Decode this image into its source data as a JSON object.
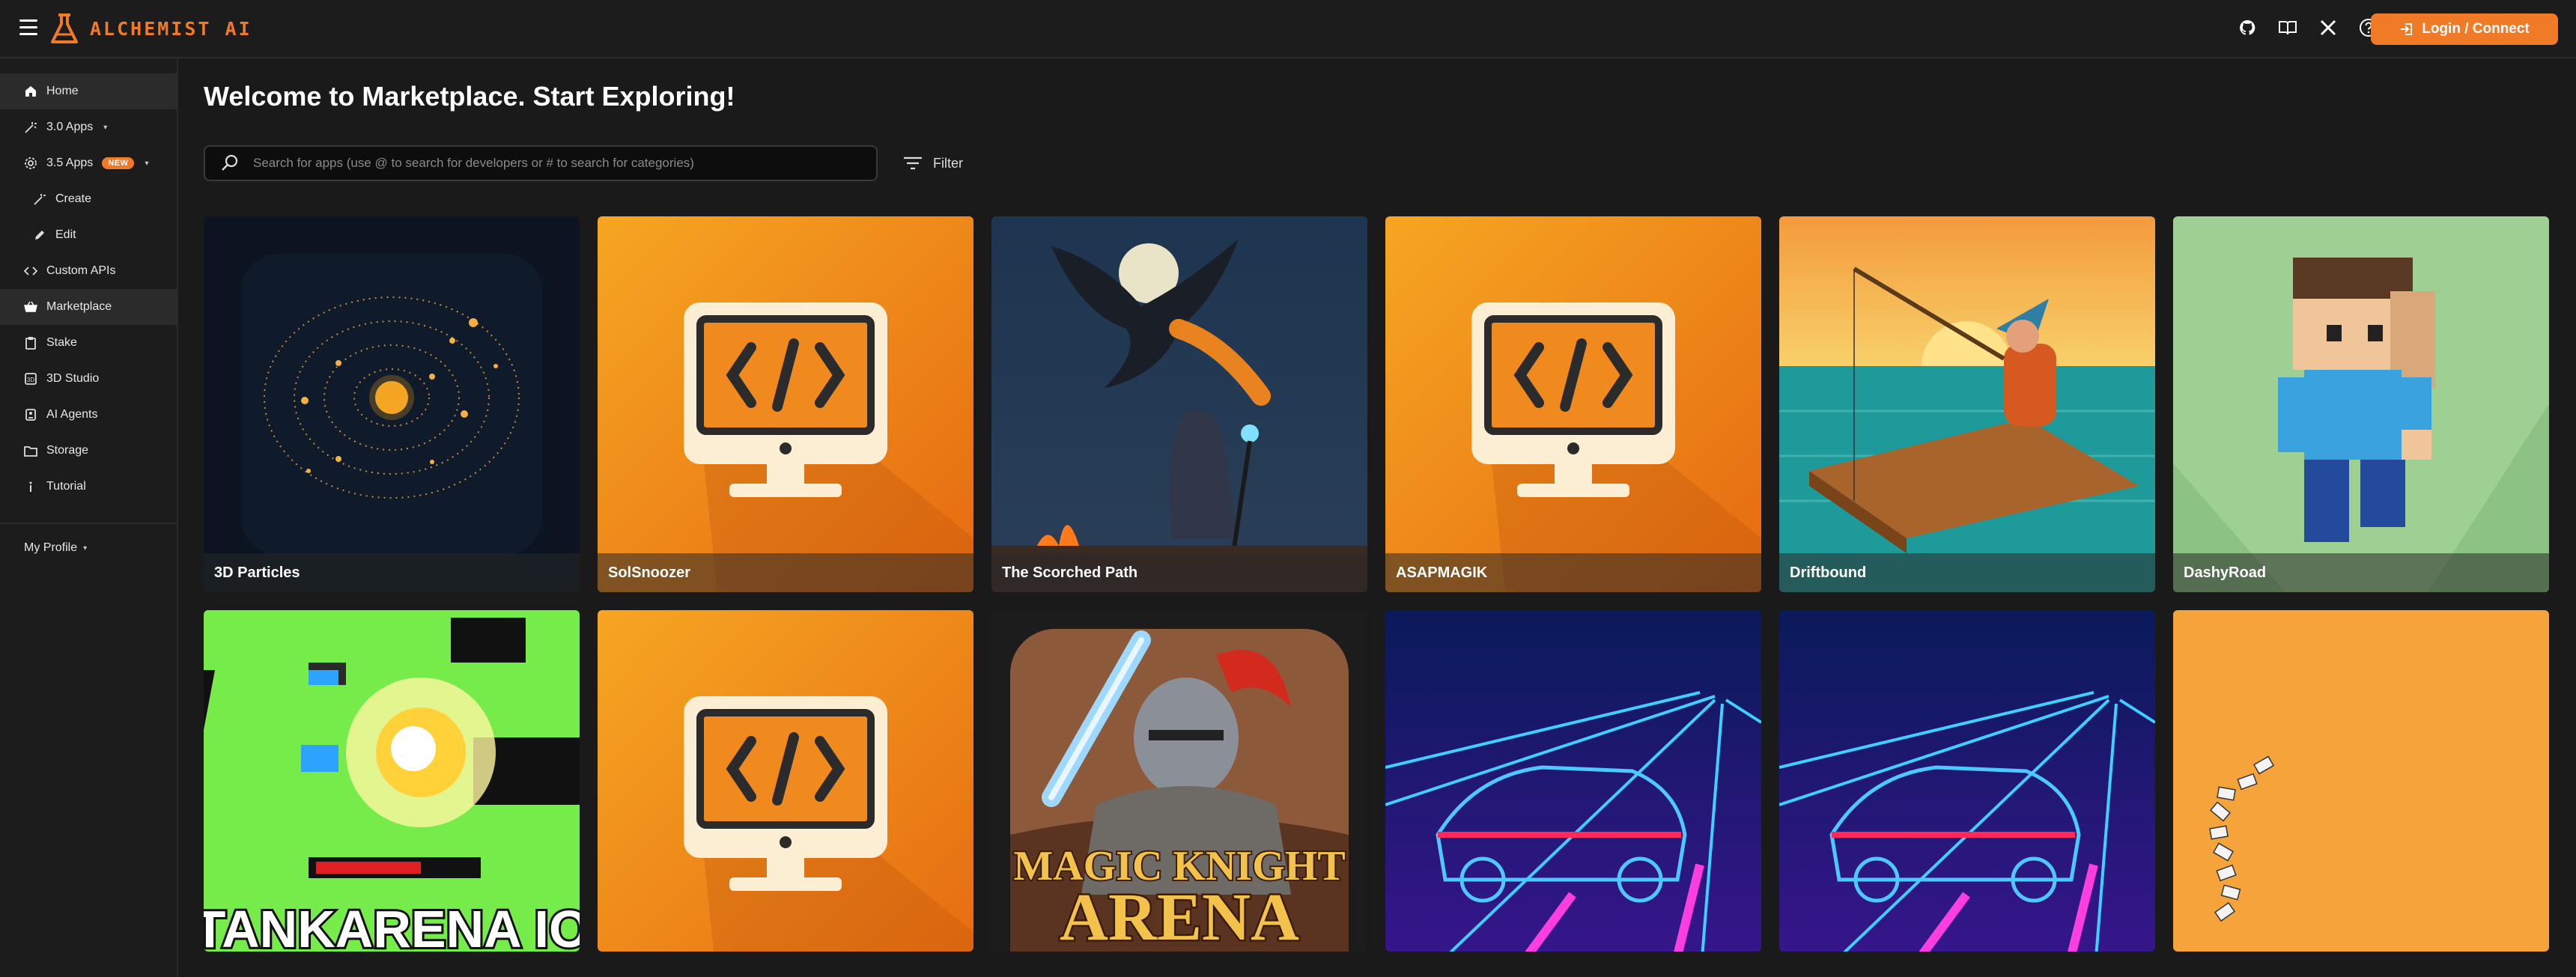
{
  "header": {
    "app_name": "ALCHEMIST AI",
    "login_label": "Login / Connect",
    "icons": [
      "github-icon",
      "book-icon",
      "x-icon",
      "help-icon"
    ]
  },
  "sidebar": {
    "items": [
      {
        "label": "Home",
        "icon": "home-icon"
      },
      {
        "label": "3.0 Apps",
        "icon": "wand-icon"
      },
      {
        "label": "3.5 Apps",
        "icon": "gear-icon",
        "badge": "NEW"
      },
      {
        "label": "Create",
        "icon": "wand-icon"
      },
      {
        "label": "Edit",
        "icon": "pencil-icon"
      },
      {
        "label": "Custom APIs",
        "icon": "code-icon"
      },
      {
        "label": "Marketplace",
        "icon": "basket-icon"
      },
      {
        "label": "Stake",
        "icon": "clipboard-icon"
      },
      {
        "label": "3D Studio",
        "icon": "cube-icon"
      },
      {
        "label": "AI Agents",
        "icon": "robot-icon"
      },
      {
        "label": "Storage",
        "icon": "folder-icon"
      },
      {
        "label": "Tutorial",
        "icon": "info-icon"
      }
    ],
    "profile_label": "My Profile"
  },
  "main": {
    "title": "Welcome to Marketplace. Start Exploring!",
    "search_placeholder": "Search for apps (use @ to search for developers or # to search for categories)",
    "filter_label": "Filter",
    "apps": [
      {
        "name": "3D Particles"
      },
      {
        "name": "SolSnoozer"
      },
      {
        "name": "The Scorched Path"
      },
      {
        "name": "ASAPMAGIK"
      },
      {
        "name": "Driftbound"
      },
      {
        "name": "DashyRoad"
      },
      {
        "name": "",
        "art_text": "TANKARENA IO"
      },
      {
        "name": ""
      },
      {
        "name": "",
        "art_text_1": "MAGIC KNIGHT",
        "art_text_2": "ARENA"
      },
      {
        "name": ""
      },
      {
        "name": ""
      },
      {
        "name": ""
      }
    ]
  },
  "colors": {
    "accent": "#f07a26",
    "background": "#1a1a1a",
    "sidebar_active": "#2b2b2b"
  }
}
